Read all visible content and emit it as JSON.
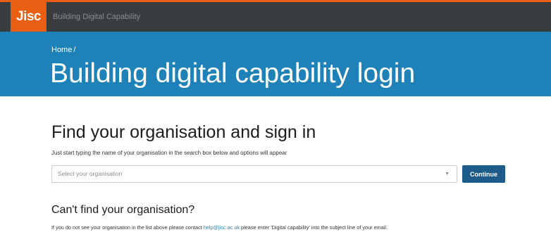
{
  "header": {
    "logo_text": "Jisc",
    "site_name": "Building Digital Capability"
  },
  "hero": {
    "breadcrumb_home": "Home",
    "breadcrumb_separator": "/",
    "title": "Building digital capability login"
  },
  "main": {
    "section_title": "Find your organisation and sign in",
    "section_help": "Just start typing the name of your organisation in the search box below and options will appear",
    "select_placeholder": "Select your organisation",
    "continue_label": "Continue",
    "cant_find_title": "Can't find your organisation?",
    "cant_find_text_before": "If you do not see your organisation in the list above please contact ",
    "cant_find_email": "help@jisc.ac.uk",
    "cant_find_text_after": " please enter 'Digital capability' into the subject line of your email."
  },
  "colors": {
    "brand_orange": "#e85e13",
    "topbar": "#3a3d3f",
    "hero_blue": "#1e82b9",
    "button_blue": "#1d5c8a"
  }
}
